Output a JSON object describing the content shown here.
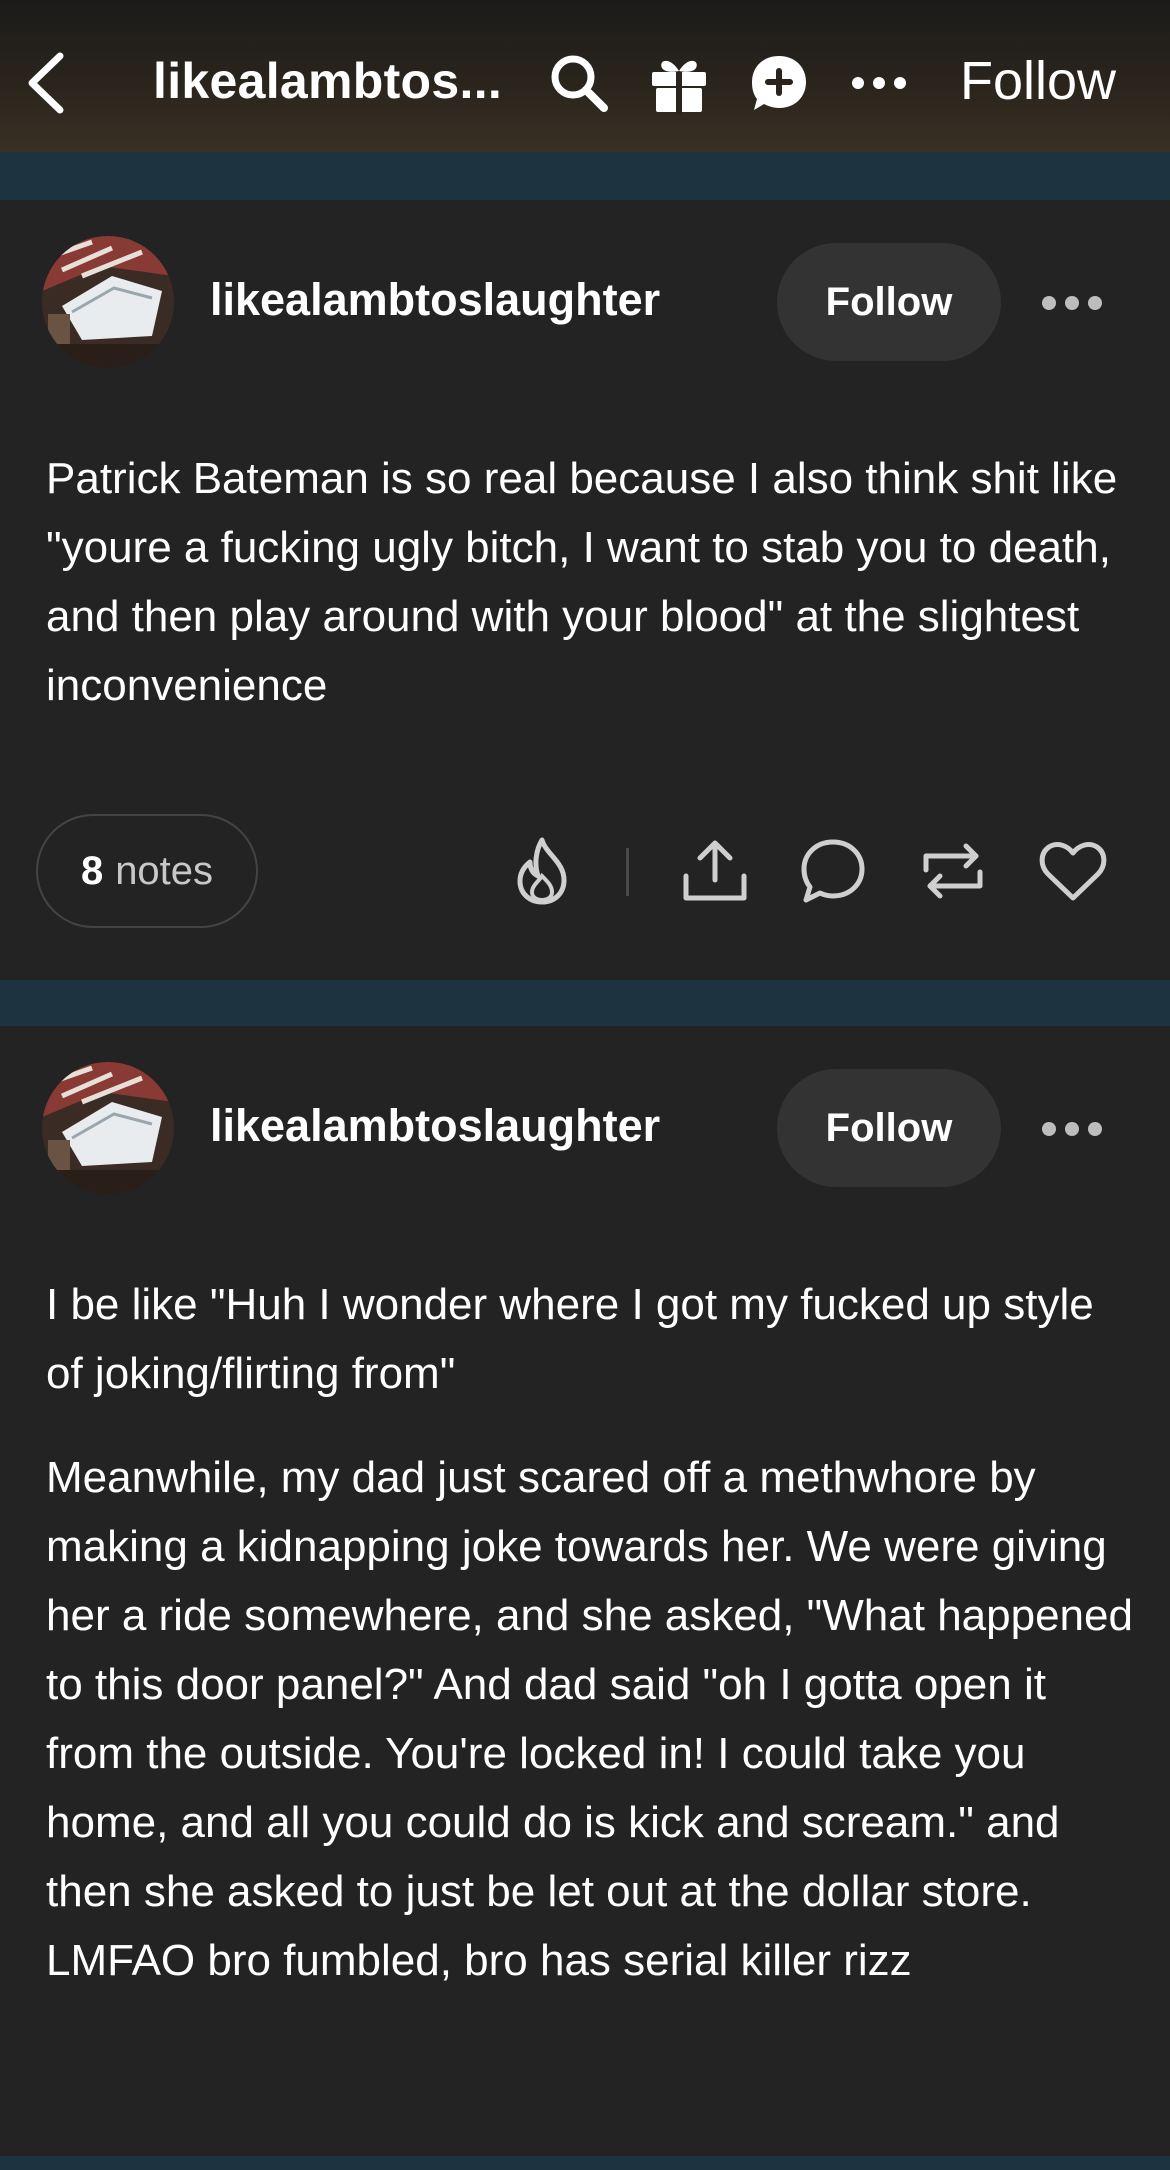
{
  "topbar": {
    "blog_title": "likealambtos...",
    "follow_label": "Follow"
  },
  "posts": [
    {
      "username": "likealambtoslaughter",
      "follow_label": "Follow",
      "paragraphs": [
        "Patrick Bateman is so real because I also think shit like \"youre a fucking ugly bitch, I want to stab you to death, and then play around with your blood\" at the slightest inconvenience"
      ],
      "notes_count": "8",
      "notes_label": "notes"
    },
    {
      "username": "likealambtoslaughter",
      "follow_label": "Follow",
      "paragraphs": [
        "I be like \"Huh I wonder where I got my fucked up style of joking/flirting from\"",
        "Meanwhile, my dad just scared off a methwhore by making a kidnapping joke towards her. We were giving her a ride somewhere, and she asked, \"What happened to this door panel?\" And dad said \"oh I gotta open it from the outside. You're locked in! I could take you home, and all you could do is kick and scream.\" and then she asked to just be let out at the dollar store. LMFAO bro fumbled, bro has serial killer rizz"
      ]
    }
  ],
  "icons": {
    "topbar": [
      "back-chevron-icon",
      "search-icon",
      "gift-icon",
      "new-post-plus-icon",
      "more-dots-icon"
    ],
    "post_actions": [
      "blaze-flame-icon",
      "share-icon",
      "reply-comment-icon",
      "reblog-icon",
      "like-heart-icon"
    ]
  },
  "colors": {
    "background_strip": "#1e3340",
    "post_background": "#232323",
    "follow_button": "#333333",
    "text": "#ffffff"
  }
}
